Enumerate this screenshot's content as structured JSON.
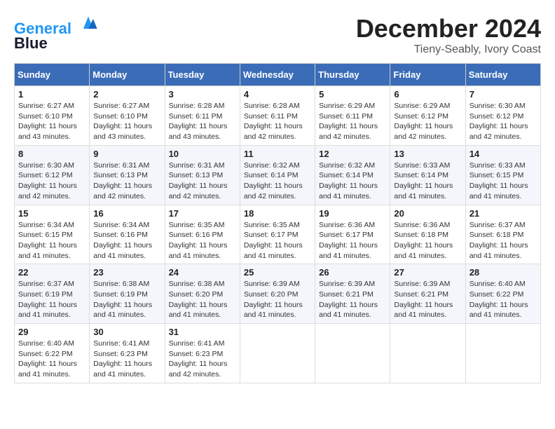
{
  "header": {
    "logo_line1": "General",
    "logo_line2": "Blue",
    "month_title": "December 2024",
    "location": "Tieny-Seably, Ivory Coast"
  },
  "weekdays": [
    "Sunday",
    "Monday",
    "Tuesday",
    "Wednesday",
    "Thursday",
    "Friday",
    "Saturday"
  ],
  "weeks": [
    [
      {
        "day": "1",
        "info": "Sunrise: 6:27 AM\nSunset: 6:10 PM\nDaylight: 11 hours and 43 minutes."
      },
      {
        "day": "2",
        "info": "Sunrise: 6:27 AM\nSunset: 6:10 PM\nDaylight: 11 hours and 43 minutes."
      },
      {
        "day": "3",
        "info": "Sunrise: 6:28 AM\nSunset: 6:11 PM\nDaylight: 11 hours and 43 minutes."
      },
      {
        "day": "4",
        "info": "Sunrise: 6:28 AM\nSunset: 6:11 PM\nDaylight: 11 hours and 42 minutes."
      },
      {
        "day": "5",
        "info": "Sunrise: 6:29 AM\nSunset: 6:11 PM\nDaylight: 11 hours and 42 minutes."
      },
      {
        "day": "6",
        "info": "Sunrise: 6:29 AM\nSunset: 6:12 PM\nDaylight: 11 hours and 42 minutes."
      },
      {
        "day": "7",
        "info": "Sunrise: 6:30 AM\nSunset: 6:12 PM\nDaylight: 11 hours and 42 minutes."
      }
    ],
    [
      {
        "day": "8",
        "info": "Sunrise: 6:30 AM\nSunset: 6:12 PM\nDaylight: 11 hours and 42 minutes."
      },
      {
        "day": "9",
        "info": "Sunrise: 6:31 AM\nSunset: 6:13 PM\nDaylight: 11 hours and 42 minutes."
      },
      {
        "day": "10",
        "info": "Sunrise: 6:31 AM\nSunset: 6:13 PM\nDaylight: 11 hours and 42 minutes."
      },
      {
        "day": "11",
        "info": "Sunrise: 6:32 AM\nSunset: 6:14 PM\nDaylight: 11 hours and 42 minutes."
      },
      {
        "day": "12",
        "info": "Sunrise: 6:32 AM\nSunset: 6:14 PM\nDaylight: 11 hours and 41 minutes."
      },
      {
        "day": "13",
        "info": "Sunrise: 6:33 AM\nSunset: 6:14 PM\nDaylight: 11 hours and 41 minutes."
      },
      {
        "day": "14",
        "info": "Sunrise: 6:33 AM\nSunset: 6:15 PM\nDaylight: 11 hours and 41 minutes."
      }
    ],
    [
      {
        "day": "15",
        "info": "Sunrise: 6:34 AM\nSunset: 6:15 PM\nDaylight: 11 hours and 41 minutes."
      },
      {
        "day": "16",
        "info": "Sunrise: 6:34 AM\nSunset: 6:16 PM\nDaylight: 11 hours and 41 minutes."
      },
      {
        "day": "17",
        "info": "Sunrise: 6:35 AM\nSunset: 6:16 PM\nDaylight: 11 hours and 41 minutes."
      },
      {
        "day": "18",
        "info": "Sunrise: 6:35 AM\nSunset: 6:17 PM\nDaylight: 11 hours and 41 minutes."
      },
      {
        "day": "19",
        "info": "Sunrise: 6:36 AM\nSunset: 6:17 PM\nDaylight: 11 hours and 41 minutes."
      },
      {
        "day": "20",
        "info": "Sunrise: 6:36 AM\nSunset: 6:18 PM\nDaylight: 11 hours and 41 minutes."
      },
      {
        "day": "21",
        "info": "Sunrise: 6:37 AM\nSunset: 6:18 PM\nDaylight: 11 hours and 41 minutes."
      }
    ],
    [
      {
        "day": "22",
        "info": "Sunrise: 6:37 AM\nSunset: 6:19 PM\nDaylight: 11 hours and 41 minutes."
      },
      {
        "day": "23",
        "info": "Sunrise: 6:38 AM\nSunset: 6:19 PM\nDaylight: 11 hours and 41 minutes."
      },
      {
        "day": "24",
        "info": "Sunrise: 6:38 AM\nSunset: 6:20 PM\nDaylight: 11 hours and 41 minutes."
      },
      {
        "day": "25",
        "info": "Sunrise: 6:39 AM\nSunset: 6:20 PM\nDaylight: 11 hours and 41 minutes."
      },
      {
        "day": "26",
        "info": "Sunrise: 6:39 AM\nSunset: 6:21 PM\nDaylight: 11 hours and 41 minutes."
      },
      {
        "day": "27",
        "info": "Sunrise: 6:39 AM\nSunset: 6:21 PM\nDaylight: 11 hours and 41 minutes."
      },
      {
        "day": "28",
        "info": "Sunrise: 6:40 AM\nSunset: 6:22 PM\nDaylight: 11 hours and 41 minutes."
      }
    ],
    [
      {
        "day": "29",
        "info": "Sunrise: 6:40 AM\nSunset: 6:22 PM\nDaylight: 11 hours and 41 minutes."
      },
      {
        "day": "30",
        "info": "Sunrise: 6:41 AM\nSunset: 6:23 PM\nDaylight: 11 hours and 41 minutes."
      },
      {
        "day": "31",
        "info": "Sunrise: 6:41 AM\nSunset: 6:23 PM\nDaylight: 11 hours and 42 minutes."
      },
      null,
      null,
      null,
      null
    ]
  ]
}
